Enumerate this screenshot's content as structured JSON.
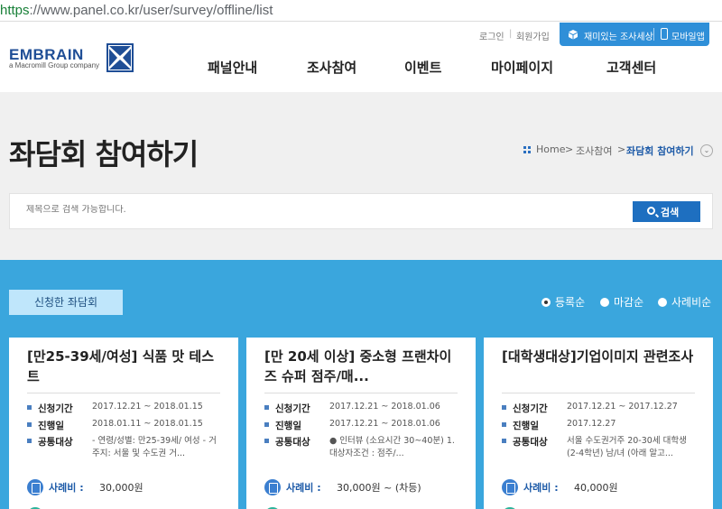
{
  "browser": {
    "url_scheme": "https",
    "url_rest": "://www.panel.co.kr/user/survey/offline/list"
  },
  "header": {
    "logo_text": "EMBRAIN",
    "logo_sub": "a Macromill Group company",
    "login": "로그인",
    "separator": "|",
    "join": "회원가입",
    "fun_survey": "재미있는 조사세상",
    "mobile_app": "모바일앱",
    "nav": [
      "패널안내",
      "조사참여",
      "이벤트",
      "마이페이지",
      "고객센터"
    ]
  },
  "page": {
    "title": "좌담회 참여하기",
    "breadcrumb": [
      "Home",
      "조사참여",
      "좌담회 참여하기"
    ],
    "crumb_sep": ">"
  },
  "search": {
    "placeholder": "제목으로 검색 가능합니다.",
    "button": "검색"
  },
  "list": {
    "applied_tab": "신청한 좌담회",
    "sort": [
      "등록순",
      "마감순",
      "사례비순"
    ],
    "sort_selected": 0,
    "cards": [
      {
        "title": "[만25-39세/여성] 식품 맛 테스트",
        "labels": [
          "신청기간",
          "진행일",
          "공통대상"
        ],
        "period": "2017.12.21 ~ 2018.01.15",
        "date": "2018.01.11 ~ 2018.01.15",
        "target": "- 연령/성별: 만25-39세/ 여성 - 거주지: 서울 및 수도권 거...",
        "fee_label": "사례비 :",
        "fee": "30,000원"
      },
      {
        "title": "[만 20세 이상] 중소형 프랜차이즈 슈퍼 점주/매...",
        "labels": [
          "신청기간",
          "진행일",
          "공통대상"
        ],
        "period": "2017.12.21 ~ 2018.01.06",
        "date": "2017.12.21 ~ 2018.01.06",
        "target": "● 인터뷰 (소요시간 30~40분) 1. 대상자조건 : 점주/...",
        "fee_label": "사례비 :",
        "fee": "30,000원 ~ (차등)"
      },
      {
        "title": "[대학생대상]기업이미지 관련조사",
        "labels": [
          "신청기간",
          "진행일",
          "공통대상"
        ],
        "period": "2017.12.21 ~ 2017.12.27",
        "date": "2017.12.27",
        "target": "서울 수도권거주 20-30세 대학생(2-4학년) 남/녀 (아래 알고...",
        "fee_label": "사례비 :",
        "fee": "40,000원"
      }
    ]
  }
}
